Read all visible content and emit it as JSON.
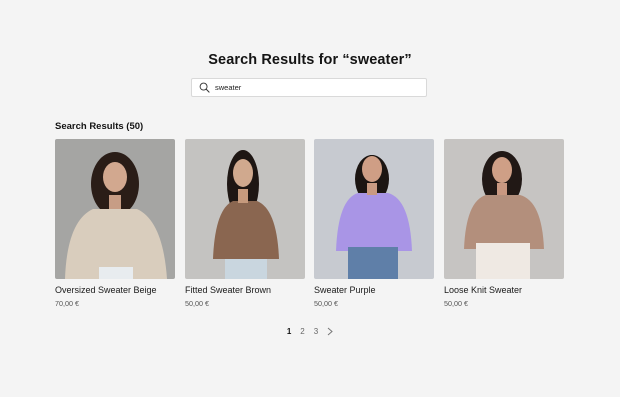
{
  "page": {
    "title": "Search Results for “sweater”"
  },
  "search": {
    "value": "sweater",
    "icon": "search-icon"
  },
  "results": {
    "heading": "Search Results (50)",
    "products": [
      {
        "name": "Oversized Sweater Beige",
        "price": "70,00 €",
        "sweater_color": "#d9cdbd",
        "bg_color": "#a5a5a3"
      },
      {
        "name": "Fitted Sweater Brown",
        "price": "50,00 €",
        "sweater_color": "#8a6650",
        "bg_color": "#c4c3c1"
      },
      {
        "name": "Sweater Purple",
        "price": "50,00 €",
        "sweater_color": "#a995e6",
        "bg_color": "#c7cad0"
      },
      {
        "name": "Loose Knit Sweater",
        "price": "50,00 €",
        "sweater_color": "#b38f7c",
        "bg_color": "#c6c4c2"
      }
    ]
  },
  "pagination": {
    "pages": [
      "1",
      "2",
      "3"
    ],
    "current": "1",
    "next_icon": "chevron-right-icon"
  }
}
